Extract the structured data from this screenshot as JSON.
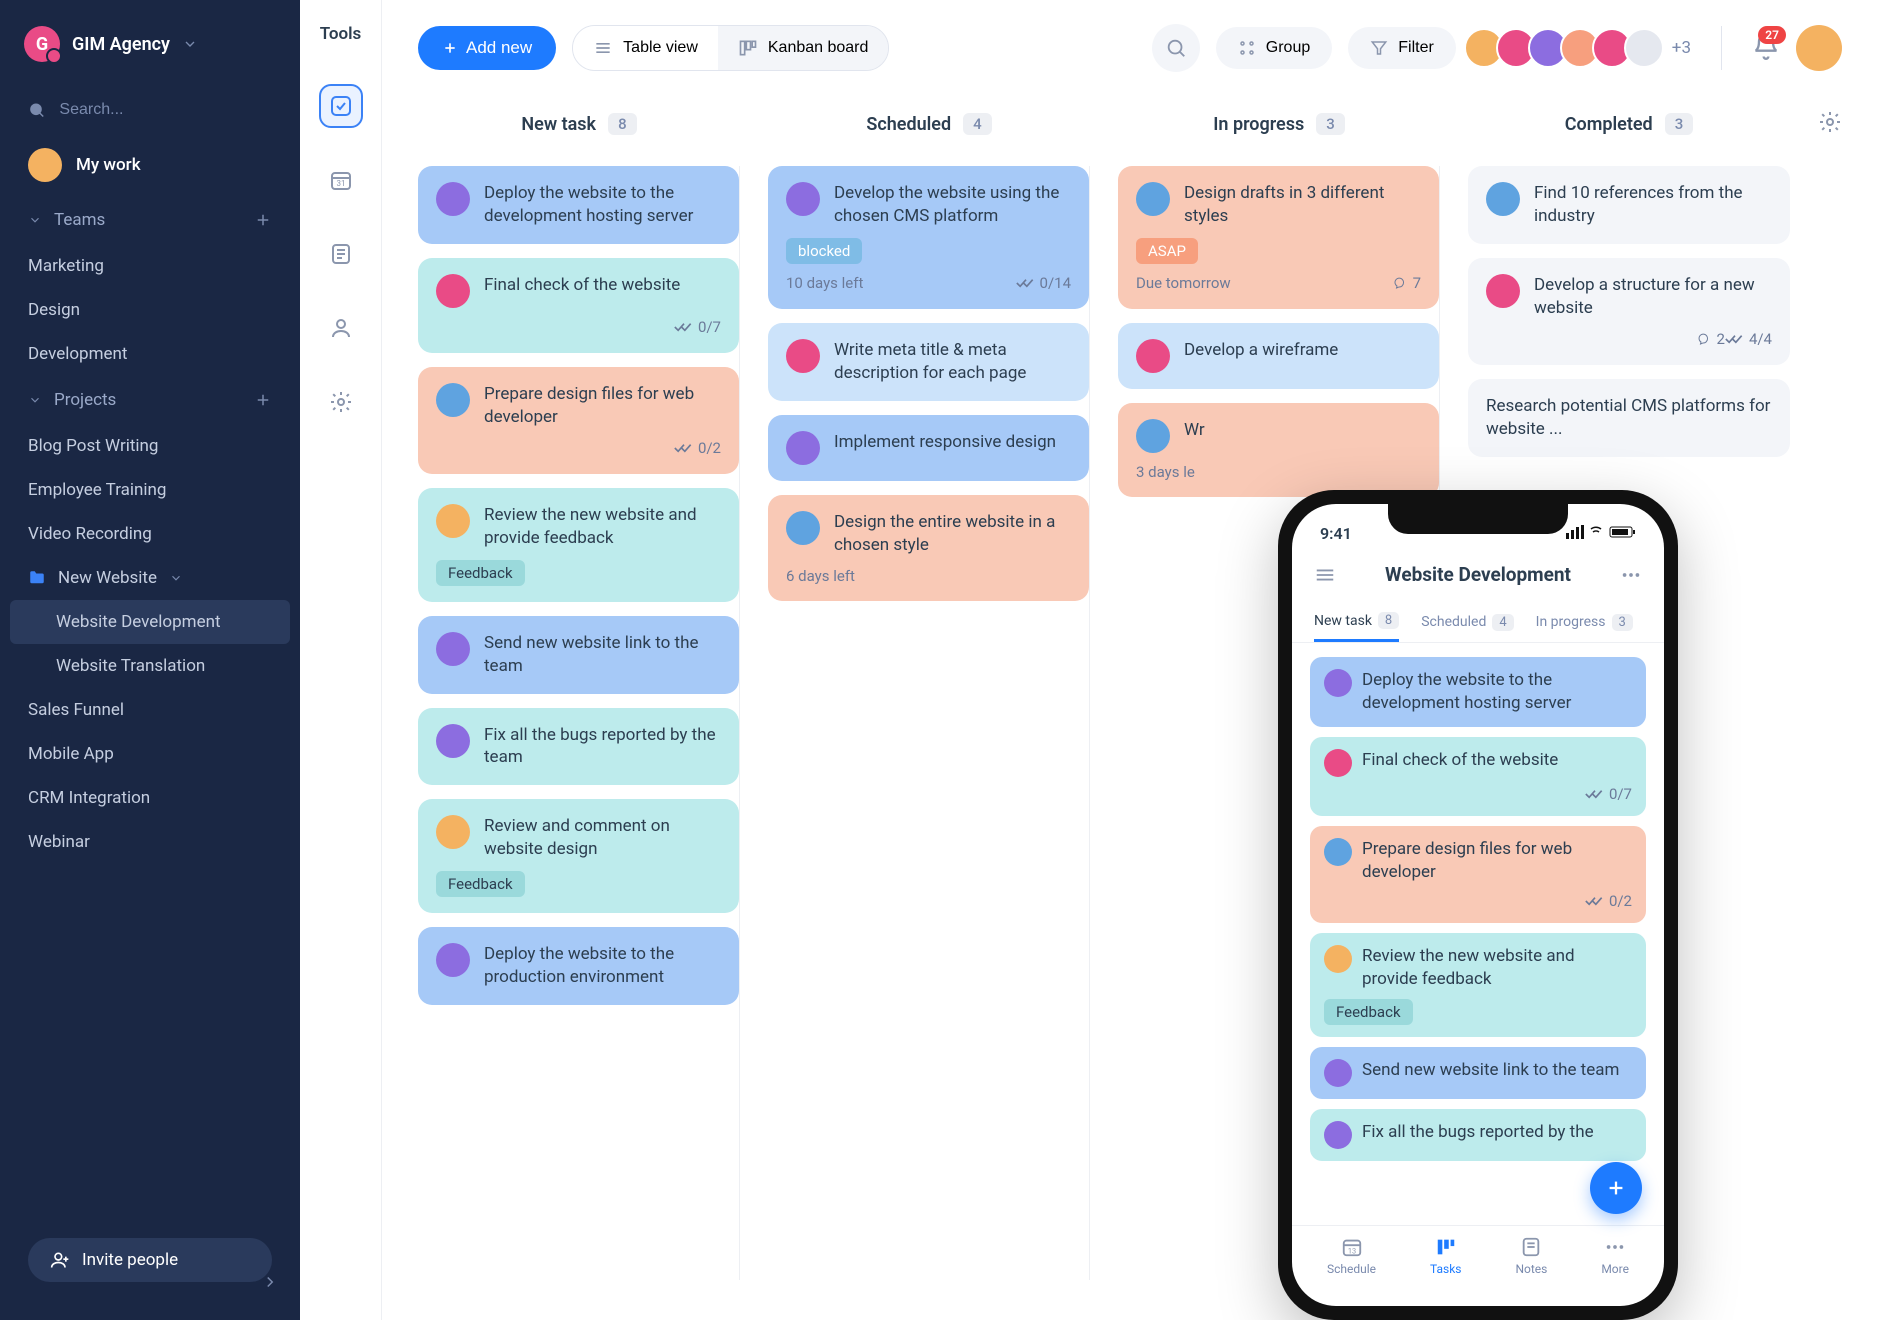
{
  "workspace": {
    "name": "GIM Agency",
    "logo_letter": "G"
  },
  "search": {
    "placeholder": "Search..."
  },
  "mywork": {
    "label": "My work"
  },
  "sections": {
    "teams": {
      "label": "Teams",
      "items": [
        "Marketing",
        "Design",
        "Development"
      ]
    },
    "projects": {
      "label": "Projects",
      "items": [
        {
          "label": "Blog Post Writing"
        },
        {
          "label": "Employee Training"
        },
        {
          "label": "Video Recording"
        },
        {
          "label": "New Website",
          "expanded": true,
          "children": [
            {
              "label": "Website Development",
              "active": true
            },
            {
              "label": "Website Translation"
            }
          ]
        },
        {
          "label": "Sales Funnel"
        },
        {
          "label": "Mobile App"
        },
        {
          "label": "CRM Integration"
        },
        {
          "label": "Webinar"
        }
      ]
    }
  },
  "invite": {
    "label": "Invite people"
  },
  "toolsbar": {
    "label": "Tools"
  },
  "topbar": {
    "add": "Add new",
    "view_table": "Table view",
    "view_kanban": "Kanban board",
    "group": "Group",
    "filter": "Filter",
    "extra_members": "+3",
    "notif_count": "27"
  },
  "avatar_colors": [
    "#f4b261",
    "#e94b86",
    "#8c6de0",
    "#f79f7e",
    "#5fa3e0",
    "#e5e8ef"
  ],
  "columns": [
    {
      "title": "New task",
      "count": "8"
    },
    {
      "title": "Scheduled",
      "count": "4"
    },
    {
      "title": "In progress",
      "count": "3"
    },
    {
      "title": "Completed",
      "count": "3"
    }
  ],
  "cards": {
    "col0": [
      {
        "title": "Deploy the website to the development hosting server",
        "bg": "bg-blue",
        "av": "#8c6de0"
      },
      {
        "title": "Final check of the website",
        "bg": "bg-cyan",
        "av": "#e94b86",
        "check": "0/7"
      },
      {
        "title": "Prepare design files for web developer",
        "bg": "bg-peach",
        "av": "#5fa3e0",
        "check": "0/2"
      },
      {
        "title": "Review the new website and provide feedback",
        "bg": "bg-cyan",
        "av": "#f4b261",
        "tag": "Feedback",
        "tagclass": "tag-feedback"
      },
      {
        "title": "Send new website link to the team",
        "bg": "bg-blue",
        "av": "#8c6de0"
      },
      {
        "title": "Fix all the bugs reported by the team",
        "bg": "bg-cyan",
        "av": "#8c6de0"
      },
      {
        "title": "Review and comment on website design",
        "bg": "bg-cyan",
        "av": "#f4b261",
        "tag": "Feedback",
        "tagclass": "tag-feedback"
      },
      {
        "title": "Deploy the website to the production environment",
        "bg": "bg-blue",
        "av": "#8c6de0"
      }
    ],
    "col1": [
      {
        "title": "Develop the website using the chosen CMS platform",
        "bg": "bg-blue",
        "av": "#8c6de0",
        "tag": "blocked",
        "tagclass": "tag-blocked",
        "footer_left": "10 days left",
        "check": "0/14"
      },
      {
        "title": "Write meta title & meta description for each page",
        "bg": "bg-lblue",
        "av": "#e94b86"
      },
      {
        "title": "Implement responsive design",
        "bg": "bg-blue",
        "av": "#8c6de0"
      },
      {
        "title": "Design the entire website in a chosen style",
        "bg": "bg-peach",
        "av": "#5fa3e0",
        "footer_left": "6 days left"
      }
    ],
    "col2": [
      {
        "title": "Design drafts in 3 different styles",
        "bg": "bg-peach",
        "av": "#5fa3e0",
        "tag": "ASAP",
        "tagclass": "tag-asap",
        "footer_left": "Due tomorrow",
        "comments": "7"
      },
      {
        "title": "Develop a wireframe",
        "bg": "bg-lblue",
        "av": "#e94b86"
      },
      {
        "title": "Wr",
        "bg": "bg-peach",
        "av": "#5fa3e0",
        "footer_left": "3 days le"
      }
    ],
    "col3": [
      {
        "title": "Find 10 references from the industry",
        "bg": "bg-grey",
        "av": "#5fa3e0"
      },
      {
        "title": "Develop a structure for a new website",
        "bg": "bg-grey",
        "av": "#e94b86",
        "comments": "2",
        "check": "4/4"
      },
      {
        "title": "Research potential CMS platforms for website ...",
        "bg": "bg-grey",
        "cut": true
      }
    ]
  },
  "phone": {
    "time": "9:41",
    "title": "Website Development",
    "tabs": [
      {
        "label": "New task",
        "count": "8",
        "active": true
      },
      {
        "label": "Scheduled",
        "count": "4"
      },
      {
        "label": "In progress",
        "count": "3"
      }
    ],
    "cards": [
      {
        "title": "Deploy the website to the development hosting server",
        "bg": "bg-blue",
        "av": "#8c6de0"
      },
      {
        "title": "Final check of the website",
        "bg": "bg-cyan",
        "av": "#e94b86",
        "check": "0/7"
      },
      {
        "title": "Prepare design files for web developer",
        "bg": "bg-peach",
        "av": "#5fa3e0",
        "check": "0/2"
      },
      {
        "title": "Review the new website and provide feedback",
        "bg": "bg-cyan",
        "av": "#f4b261",
        "tag": "Feedback",
        "tagclass": "tag-feedback"
      },
      {
        "title": "Send new website link to the team",
        "bg": "bg-blue",
        "av": "#8c6de0"
      },
      {
        "title": "Fix all the bugs reported by the",
        "bg": "bg-cyan",
        "av": "#8c6de0"
      }
    ],
    "nav": [
      {
        "label": "Schedule"
      },
      {
        "label": "Tasks",
        "active": true
      },
      {
        "label": "Notes"
      },
      {
        "label": "More"
      }
    ]
  }
}
